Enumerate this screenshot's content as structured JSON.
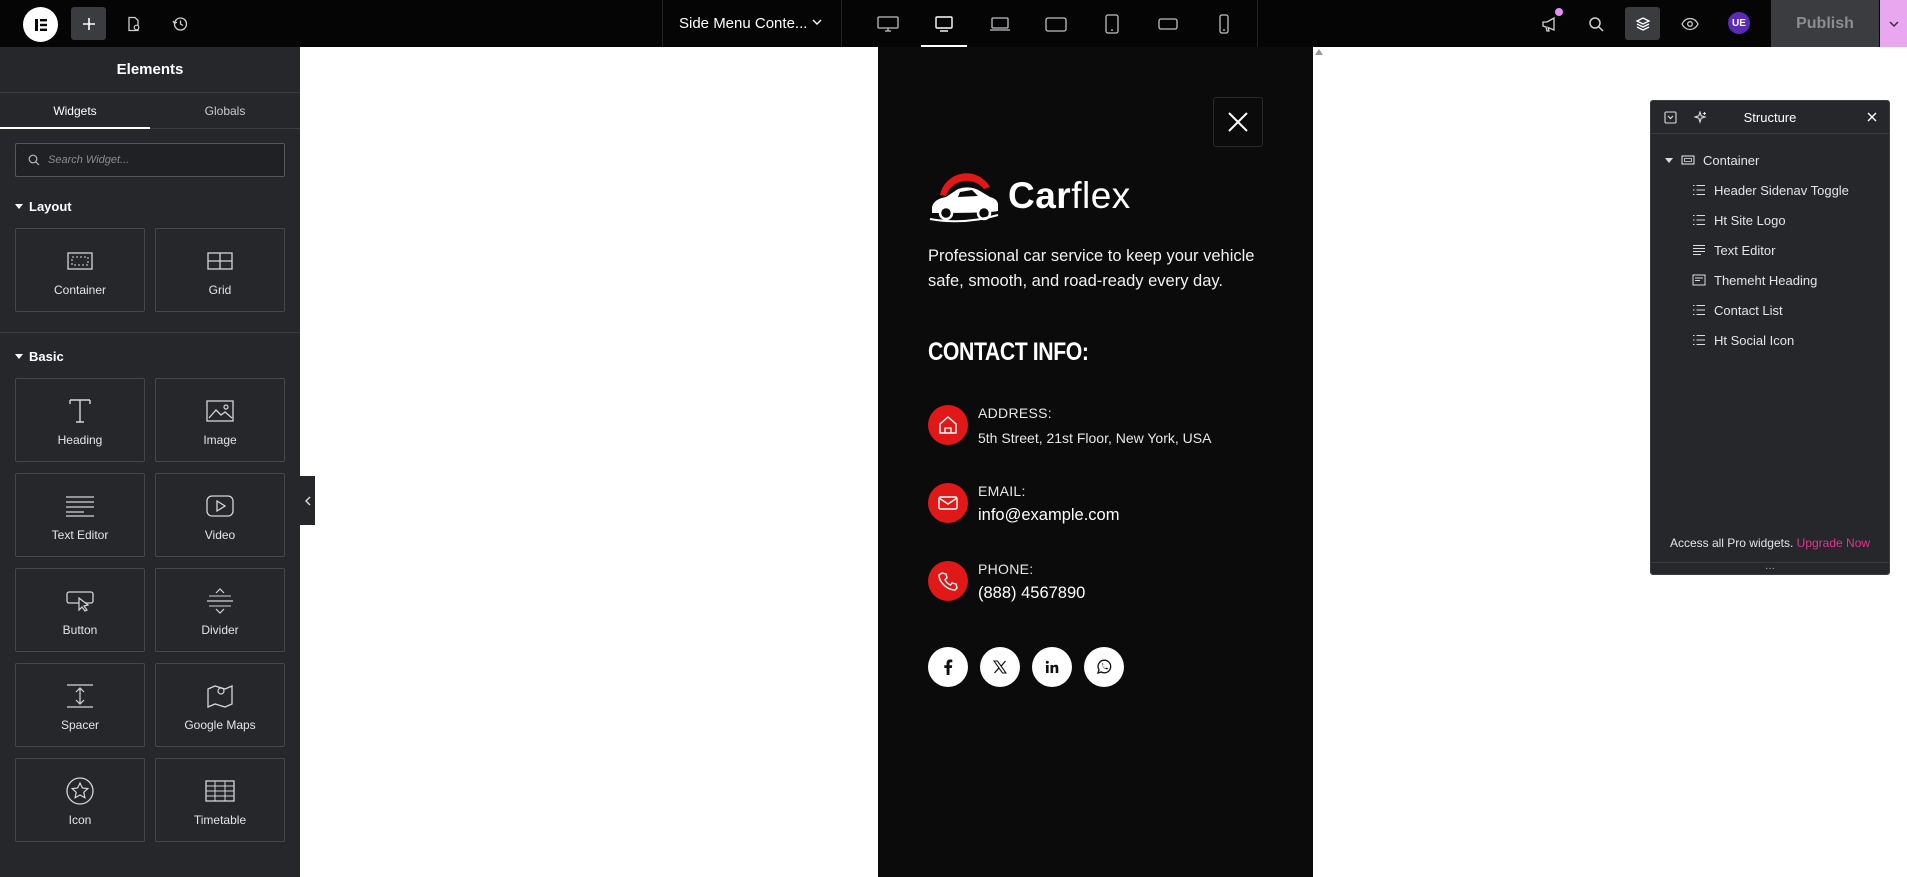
{
  "topbar": {
    "doc_title": "Side Menu Conte...",
    "publish_label": "Publish",
    "avatar_initials": "UE"
  },
  "panel": {
    "title": "Elements",
    "tabs": [
      "Widgets",
      "Globals"
    ],
    "search_placeholder": "Search Widget...",
    "sections": [
      {
        "name": "Layout",
        "widgets": [
          "Container",
          "Grid"
        ]
      },
      {
        "name": "Basic",
        "widgets": [
          "Heading",
          "Image",
          "Text Editor",
          "Video",
          "Button",
          "Divider",
          "Spacer",
          "Google Maps",
          "Icon",
          "Timetable"
        ]
      }
    ]
  },
  "canvas": {
    "logo_bold": "Car",
    "logo_light": "flex",
    "description": "Professional car service to keep your vehicle safe, smooth, and road-ready every day.",
    "contact_heading": "CONTACT INFO:",
    "contacts": [
      {
        "label": "ADDRESS:",
        "value": "5th Street, 21st Floor, New York, USA"
      },
      {
        "label": "EMAIL:",
        "value": "info@example.com"
      },
      {
        "label": "PHONE:",
        "value": "(888) 4567890"
      }
    ],
    "accent_color": "#e01818"
  },
  "structure": {
    "title": "Structure",
    "root": "Container",
    "children": [
      "Header Sidenav Toggle",
      "Ht Site Logo",
      "Text Editor",
      "Themeht Heading",
      "Contact List",
      "Ht Social Icon"
    ],
    "footer_text": "Access all Pro widgets.",
    "footer_link": "Upgrade Now"
  }
}
